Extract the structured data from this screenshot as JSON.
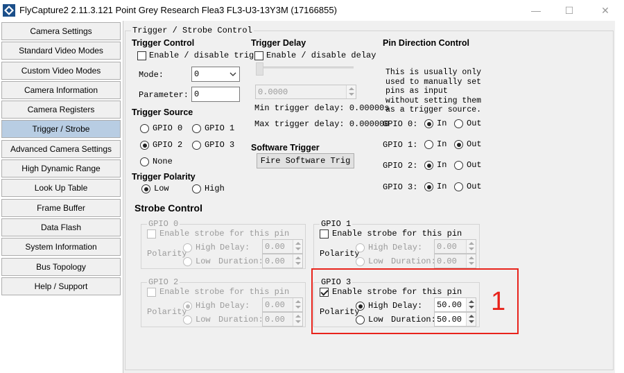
{
  "window": {
    "title": "FlyCapture2 2.11.3.121  Point Grey Research Flea3 FL3-U3-13Y3M (17166855)",
    "minimize": "—",
    "maximize": "☐",
    "close": "✕",
    "app_icon": "flycapture-logo-icon"
  },
  "nav": {
    "items": [
      "Camera Settings",
      "Standard Video Modes",
      "Custom Video Modes",
      "Camera Information",
      "Camera Registers",
      "Trigger / Strobe",
      "Advanced Camera Settings",
      "High Dynamic Range",
      "Look Up Table",
      "Frame Buffer",
      "Data Flash",
      "System Information",
      "Bus Topology",
      "Help / Support"
    ],
    "active": "Trigger / Strobe"
  },
  "trigger_strobe": {
    "group_title": "Trigger / Strobe Control",
    "trigger_control": {
      "heading": "Trigger Control",
      "enable_label": "Enable / disable trigg",
      "mode_label": "Mode:",
      "mode_value": "0",
      "parameter_label": "Parameter:",
      "parameter_value": "0"
    },
    "trigger_source": {
      "heading": "Trigger Source",
      "options": [
        "GPIO 0",
        "GPIO 1",
        "GPIO 2",
        "GPIO 3",
        "None"
      ],
      "selected": "GPIO 2"
    },
    "trigger_polarity": {
      "heading": "Trigger Polarity",
      "options": [
        "Low",
        "High"
      ],
      "selected": "Low"
    },
    "trigger_delay": {
      "heading": "Trigger Delay",
      "enable_label": "Enable / disable delay",
      "value": "0.0000",
      "min_label": "Min trigger delay: 0.00000s",
      "max_label": "Max trigger delay: 0.000000"
    },
    "software_trigger": {
      "heading": "Software Trigger",
      "button_label": "Fire Software Trig"
    },
    "pin_direction": {
      "heading": "Pin Direction Control",
      "description": [
        "This is usually only",
        "used to manually set",
        "pins as input",
        "without setting them",
        "as a trigger source."
      ],
      "in_label": "In",
      "out_label": "Out",
      "pins": [
        {
          "label": "GPIO 0:",
          "direction": "In"
        },
        {
          "label": "GPIO 1:",
          "direction": "Out"
        },
        {
          "label": "GPIO 2:",
          "direction": "In"
        },
        {
          "label": "GPIO 3:",
          "direction": "In"
        }
      ]
    },
    "strobe_control": {
      "heading": "Strobe Control",
      "enable_label": "Enable strobe for this pin",
      "polarity_label": "Polarity",
      "high_label": "High",
      "low_label": "Low",
      "delay_label": "Delay:",
      "duration_label": "Duration:",
      "pins": [
        {
          "title": "GPIO 0",
          "enabled": false,
          "polarity": "none",
          "delay": "0.00",
          "duration": "0.00",
          "available": false
        },
        {
          "title": "GPIO 1",
          "enabled": false,
          "polarity": "none",
          "delay": "0.00",
          "duration": "0.00",
          "available": true
        },
        {
          "title": "GPIO 2",
          "enabled": false,
          "polarity": "High",
          "delay": "0.00",
          "duration": "0.00",
          "available": false
        },
        {
          "title": "GPIO 3",
          "enabled": true,
          "polarity": "High",
          "delay": "50.00",
          "duration": "50.00",
          "available": true
        }
      ]
    }
  },
  "annotation": {
    "number": "1",
    "color": "#e8231b"
  }
}
